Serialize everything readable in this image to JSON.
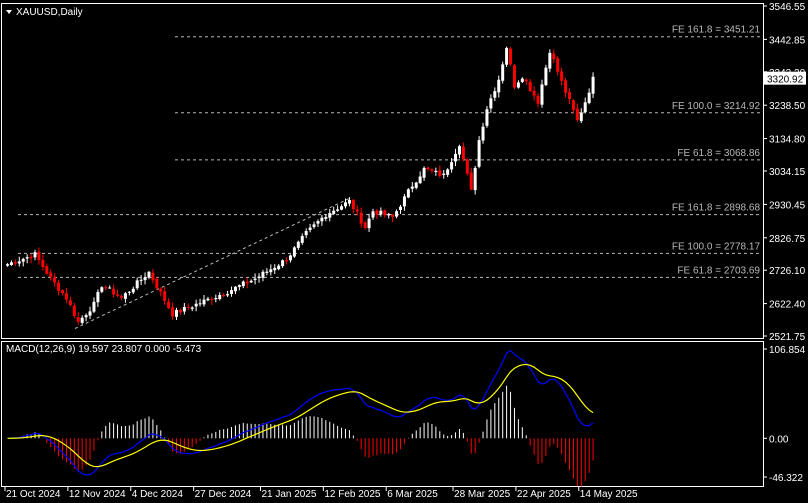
{
  "title": "XAUUSD,Daily",
  "colors": {
    "bull": "#ffffff",
    "bear": "#ff0000",
    "macd": "#0000ff",
    "signal": "#ffff00",
    "grid": "#ffffff",
    "fe": "#b8b8b8"
  },
  "price_axis": {
    "min": 2521.75,
    "max": 3546.55,
    "ticks": [
      "3546.55",
      "3442.85",
      "3342.20",
      "3238.50",
      "3134.80",
      "3034.15",
      "2930.45",
      "2826.75",
      "2726.10",
      "2622.40",
      "2521.75"
    ]
  },
  "current_price": "3320.92",
  "fe_levels": [
    {
      "label": "FE 161.8 = 3451.21",
      "value": 3451.21,
      "group": "upper"
    },
    {
      "label": "FE 100.0 = 3214.92",
      "value": 3214.92,
      "group": "upper"
    },
    {
      "label": "FE 61.8 = 3068.86",
      "value": 3068.86,
      "group": "upper"
    },
    {
      "label": "FE 161.8 = 2898.68",
      "value": 2898.68,
      "group": "lower"
    },
    {
      "label": "FE 100.0 = 2778.17",
      "value": 2778.17,
      "group": "lower"
    },
    {
      "label": "FE 61.8 = 2703.69",
      "value": 2703.69,
      "group": "lower"
    }
  ],
  "macd": {
    "label": "MACD(12,26,9) 19.597 23.807 0.000 -5.473",
    "max": 106.854,
    "min": -46.322,
    "ticks": [
      "106.854",
      "0.00",
      "-46.322"
    ]
  },
  "dates": [
    {
      "label": "21 Oct 2024",
      "bar": 0
    },
    {
      "label": "12 Nov 2024",
      "bar": 16
    },
    {
      "label": "4 Dec 2024",
      "bar": 32
    },
    {
      "label": "27 Dec 2024",
      "bar": 48
    },
    {
      "label": "21 Jan 2025",
      "bar": 65
    },
    {
      "label": "12 Feb 2025",
      "bar": 81
    },
    {
      "label": "6 Mar 2025",
      "bar": 97
    },
    {
      "label": "28 Mar 2025",
      "bar": 114
    },
    {
      "label": "22 Apr 2025",
      "bar": 130
    },
    {
      "label": "14 May 2025",
      "bar": 146
    }
  ],
  "chart_data": {
    "type": "candlestick",
    "symbol": "XAUUSD",
    "timeframe": "Daily",
    "anchors": [
      [
        0,
        2745
      ],
      [
        7,
        2775
      ],
      [
        11,
        2700
      ],
      [
        15,
        2640
      ],
      [
        18,
        2565
      ],
      [
        22,
        2620
      ],
      [
        24,
        2680
      ],
      [
        29,
        2640
      ],
      [
        36,
        2720
      ],
      [
        42,
        2590
      ],
      [
        48,
        2620
      ],
      [
        56,
        2660
      ],
      [
        63,
        2700
      ],
      [
        71,
        2760
      ],
      [
        76,
        2840
      ],
      [
        81,
        2900
      ],
      [
        87,
        2940
      ],
      [
        91,
        2860
      ],
      [
        93,
        2910
      ],
      [
        98,
        2890
      ],
      [
        103,
        2990
      ],
      [
        106,
        3040
      ],
      [
        111,
        3020
      ],
      [
        115,
        3120
      ],
      [
        118,
        2970
      ],
      [
        120,
        3130
      ],
      [
        122,
        3230
      ],
      [
        125,
        3320
      ],
      [
        127,
        3420
      ],
      [
        129,
        3300
      ],
      [
        131,
        3330
      ],
      [
        135,
        3250
      ],
      [
        138,
        3410
      ],
      [
        141,
        3310
      ],
      [
        145,
        3190
      ],
      [
        147,
        3250
      ],
      [
        149,
        3320
      ]
    ]
  }
}
